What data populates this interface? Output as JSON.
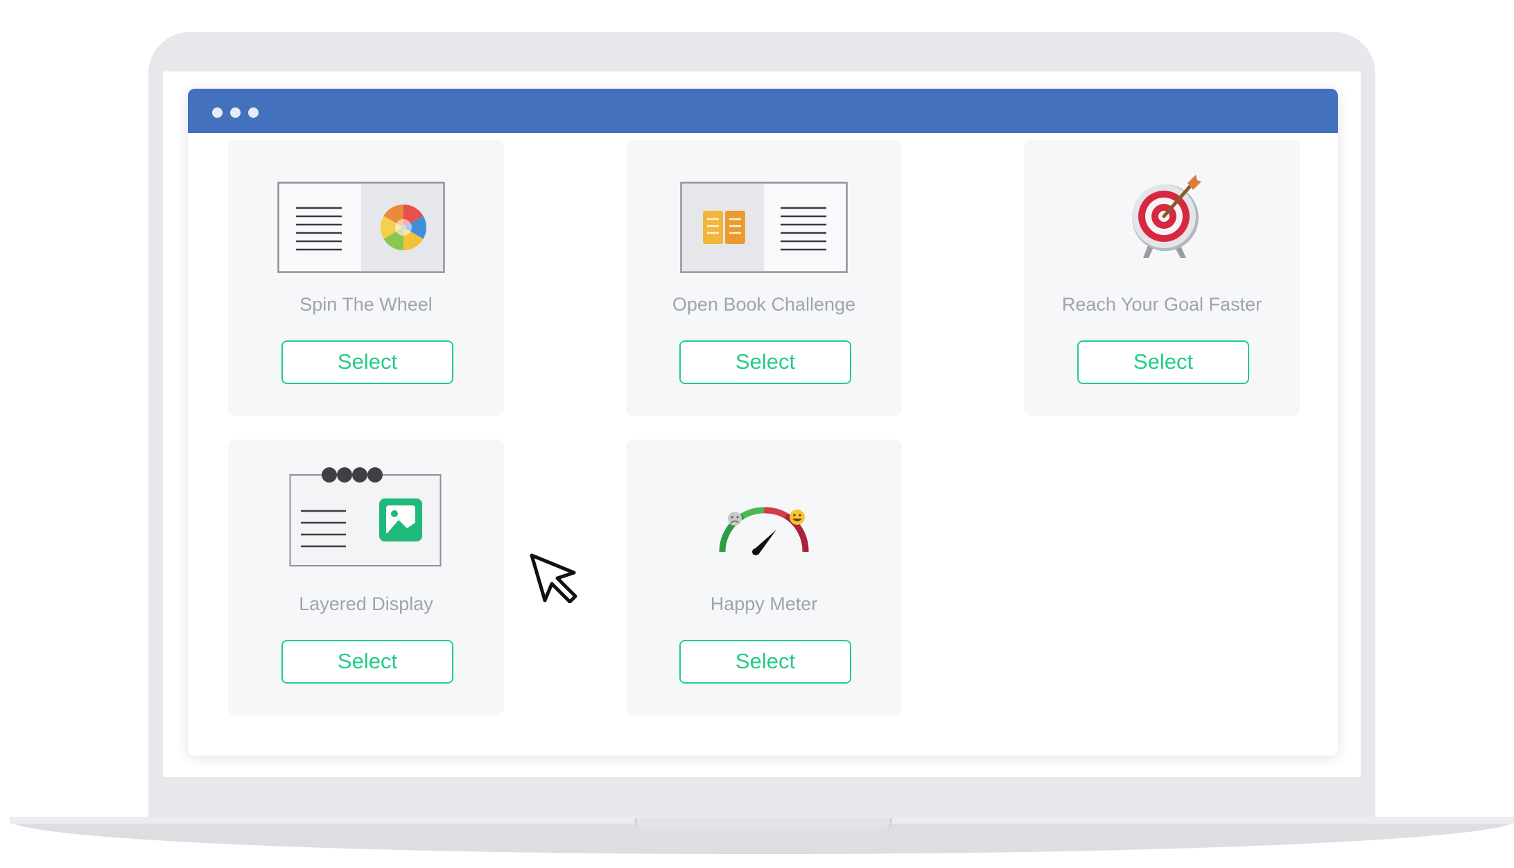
{
  "window": {
    "controls": [
      "dot",
      "dot",
      "dot"
    ]
  },
  "cards": [
    {
      "label": "Spin The Wheel",
      "button": "Select",
      "icon": "spin-wheel-icon"
    },
    {
      "label": "Open Book Challenge",
      "button": "Select",
      "icon": "open-book-icon"
    },
    {
      "label": "Reach Your Goal Faster",
      "button": "Select",
      "icon": "target-icon"
    },
    {
      "label": "Layered Display",
      "button": "Select",
      "icon": "layered-display-icon"
    },
    {
      "label": "Happy Meter",
      "button": "Select",
      "icon": "happy-meter-icon"
    }
  ],
  "colors": {
    "titlebar": "#4371be",
    "accent": "#22cc88",
    "card_bg": "#f6f7f9",
    "label_text": "#9fa3b0"
  }
}
